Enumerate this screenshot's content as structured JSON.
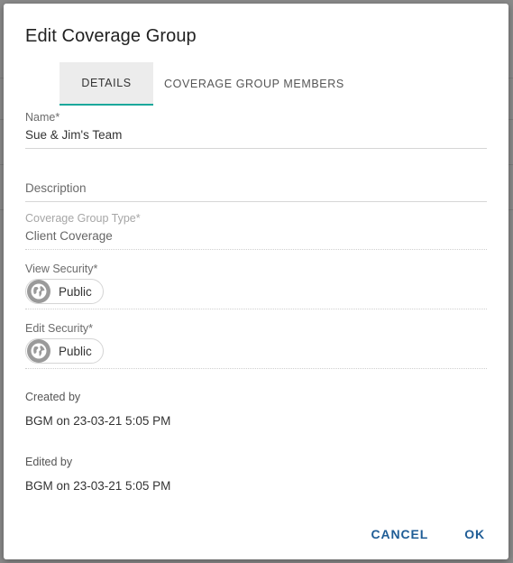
{
  "dialog": {
    "title": "Edit Coverage Group",
    "tabs": [
      {
        "label": "DETAILS",
        "active": true
      },
      {
        "label": "COVERAGE GROUP MEMBERS",
        "active": false
      }
    ]
  },
  "fields": {
    "name": {
      "label": "Name*",
      "value": "Sue & Jim's Team"
    },
    "description": {
      "label": "Description",
      "value": ""
    },
    "coverage_group_type": {
      "label": "Coverage Group Type*",
      "value": "Client Coverage",
      "disabled": true
    },
    "view_security": {
      "label": "View Security*",
      "chip": "Public",
      "icon": "globe-icon"
    },
    "edit_security": {
      "label": "Edit Security*",
      "chip": "Public",
      "icon": "globe-icon"
    }
  },
  "meta": {
    "created_by_label": "Created by",
    "created_by_value": "BGM on 23-03-21 5:05 PM",
    "edited_by_label": "Edited by",
    "edited_by_value": "BGM on 23-03-21 5:05 PM"
  },
  "actions": {
    "cancel": "CANCEL",
    "ok": "OK"
  },
  "colors": {
    "accent": "#1aa89b",
    "action_text": "#1f5d96",
    "overlay": "#8a8a8a"
  }
}
